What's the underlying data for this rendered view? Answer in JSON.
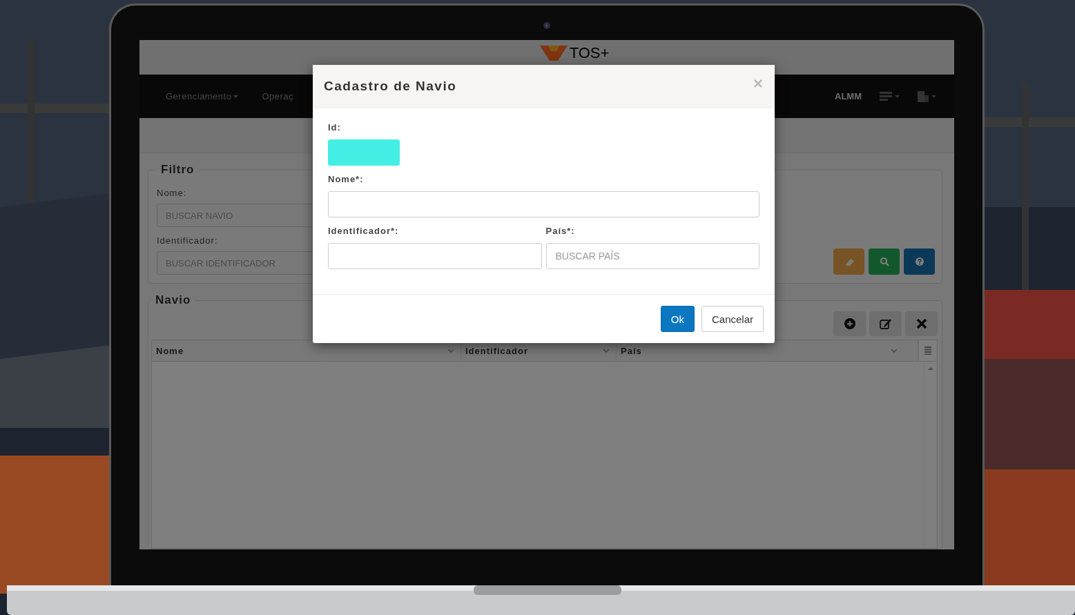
{
  "header": {
    "logo": "TOS+"
  },
  "navbar": {
    "menus": [
      {
        "label": "Gerenciamento",
        "dropdown": true
      },
      {
        "label": "Operaç",
        "dropdown": false
      }
    ],
    "user": "ALMM"
  },
  "filter": {
    "title": "Filtro",
    "fields": [
      {
        "label": "Nome:",
        "placeholder": "BUSCAR NAVIO"
      },
      {
        "label": "Identificador:",
        "placeholder": "BUSCAR IDENTIFICADOR"
      }
    ],
    "buttons": [
      {
        "kind": "clear"
      },
      {
        "kind": "search"
      },
      {
        "kind": "help"
      }
    ]
  },
  "navio": {
    "title": "Navio",
    "toolbar": [
      {
        "kind": "add"
      },
      {
        "kind": "edit"
      },
      {
        "kind": "delete"
      }
    ],
    "columns": [
      "Nome",
      "Identificador",
      "País"
    ]
  },
  "modal": {
    "title": "Cadastro de Navio",
    "rows": [
      {
        "fields": [
          {
            "label": "Id:",
            "kind": "short",
            "highlighted": true
          }
        ]
      },
      {
        "fields": [
          {
            "label": "Nome*:",
            "kind": "wide",
            "highlighted": false
          }
        ]
      },
      {
        "fields": [
          {
            "label": "Identificador*:",
            "kind": "wide",
            "highlighted": false
          },
          {
            "label": "País*:",
            "kind": "wide",
            "highlighted": false,
            "placeholder": "BUSCAR PAÍS"
          }
        ]
      }
    ],
    "buttons": [
      {
        "label": "Ok",
        "kind": "primary"
      },
      {
        "label": "Cancelar",
        "kind": "default"
      }
    ]
  }
}
